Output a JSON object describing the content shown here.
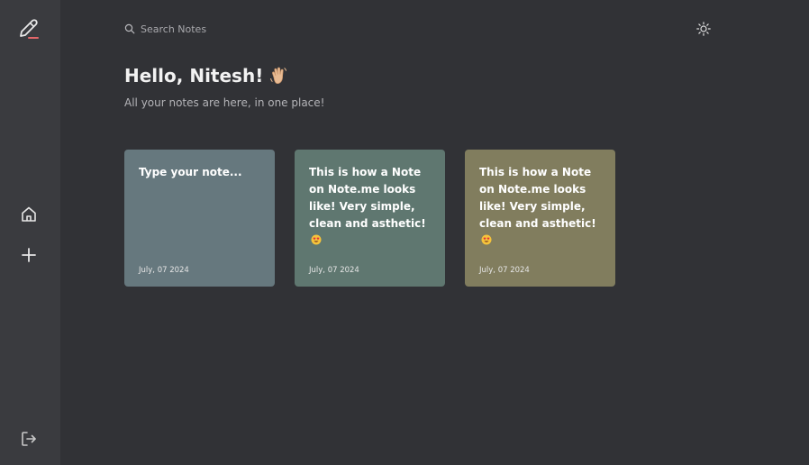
{
  "search": {
    "placeholder": "Search Notes"
  },
  "greeting": {
    "prefix": "Hello, ",
    "name": "Nitesh",
    "suffix": "!"
  },
  "subtitle": "All your notes are here, in one place!",
  "sidebar": {
    "items": [
      {
        "icon": "pencil-icon"
      },
      {
        "icon": "home-icon"
      },
      {
        "icon": "plus-icon"
      },
      {
        "icon": "logout-icon"
      }
    ]
  },
  "notes": [
    {
      "text": "Type your note...",
      "date": "July, 07 2024",
      "color": "#66787e"
    },
    {
      "text": "This is how a Note on Note.me looks like! Very simple, clean and asthetic!",
      "date": "July, 07 2024",
      "color": "#5f7770"
    },
    {
      "text": "This is how a Note on Note.me looks like! Very simple, clean and asthetic!",
      "date": "July, 07 2024",
      "color": "#817d5e"
    }
  ],
  "colors": {
    "background": "#313236",
    "sidebar": "#3a3b3f",
    "accent": "#e2676a"
  }
}
